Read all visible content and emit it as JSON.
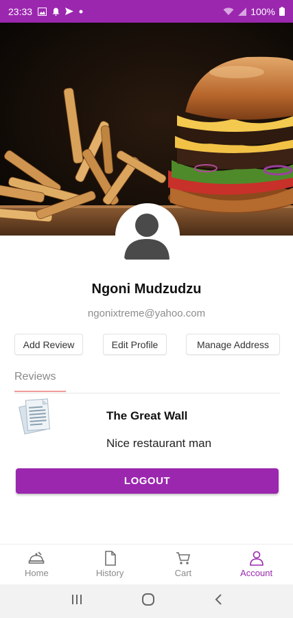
{
  "status_bar": {
    "time": "23:33",
    "battery": "100%",
    "color": "#9b27af"
  },
  "profile": {
    "name": "Ngoni Mudzudzu",
    "email": "ngonixtreme@yahoo.com"
  },
  "actions": {
    "add_review": "Add Review",
    "edit_profile": "Edit Profile",
    "manage_address": "Manage Address"
  },
  "tabs": {
    "reviews": "Reviews"
  },
  "reviews": [
    {
      "title": "The Great Wall",
      "text": "Nice restaurant man",
      "icon": "document-icon"
    }
  ],
  "logout_label": "LOGOUT",
  "bottom_nav": {
    "items": [
      {
        "label": "Home",
        "icon": "food-tray-icon"
      },
      {
        "label": "History",
        "icon": "document-icon"
      },
      {
        "label": "Cart",
        "icon": "cart-icon"
      },
      {
        "label": "Account",
        "icon": "person-icon"
      }
    ],
    "active": "Account",
    "accent": "#9b27af"
  }
}
